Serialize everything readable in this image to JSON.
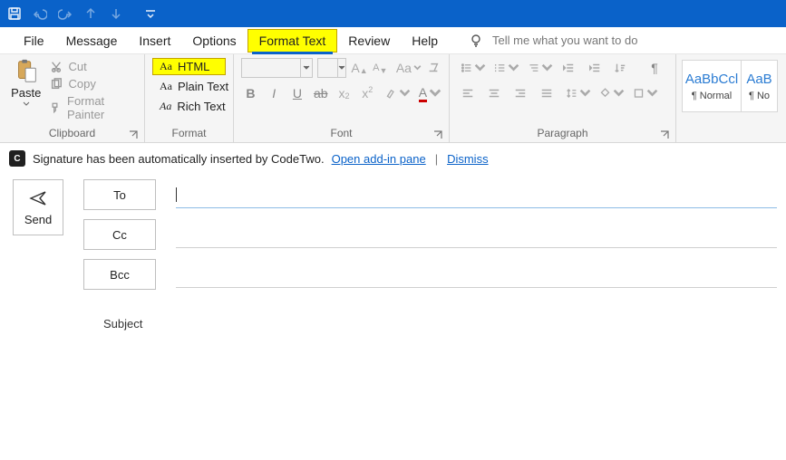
{
  "quickAccess": {
    "save": "save",
    "undo": "undo",
    "redo": "redo",
    "up": "prev",
    "down": "next",
    "more": "more"
  },
  "menu": {
    "file": "File",
    "message": "Message",
    "insert": "Insert",
    "options": "Options",
    "formatText": "Format Text",
    "review": "Review",
    "help": "Help",
    "tellMe": "Tell me what you want to do"
  },
  "ribbon": {
    "clipboard": {
      "paste": "Paste",
      "cut": "Cut",
      "copy": "Copy",
      "formatPainter": "Format Painter",
      "label": "Clipboard"
    },
    "format": {
      "html": "HTML",
      "plain": "Plain Text",
      "rich": "Rich Text",
      "aa": "Aa",
      "label": "Format"
    },
    "font": {
      "label": "Font",
      "fontName": "",
      "fontSize": ""
    },
    "paragraph": {
      "label": "Paragraph"
    },
    "styles": {
      "items": [
        {
          "preview": "AaBbCcl",
          "name": "¶ Normal"
        },
        {
          "preview": "AaB",
          "name": "¶ No"
        }
      ]
    }
  },
  "notification": {
    "text": "Signature has been automatically inserted by CodeTwo.",
    "openPane": "Open add-in pane",
    "dismiss": "Dismiss"
  },
  "compose": {
    "send": "Send",
    "to": "To",
    "cc": "Cc",
    "bcc": "Bcc",
    "subject": "Subject",
    "toValue": "",
    "ccValue": "",
    "bccValue": "",
    "subjectValue": ""
  }
}
